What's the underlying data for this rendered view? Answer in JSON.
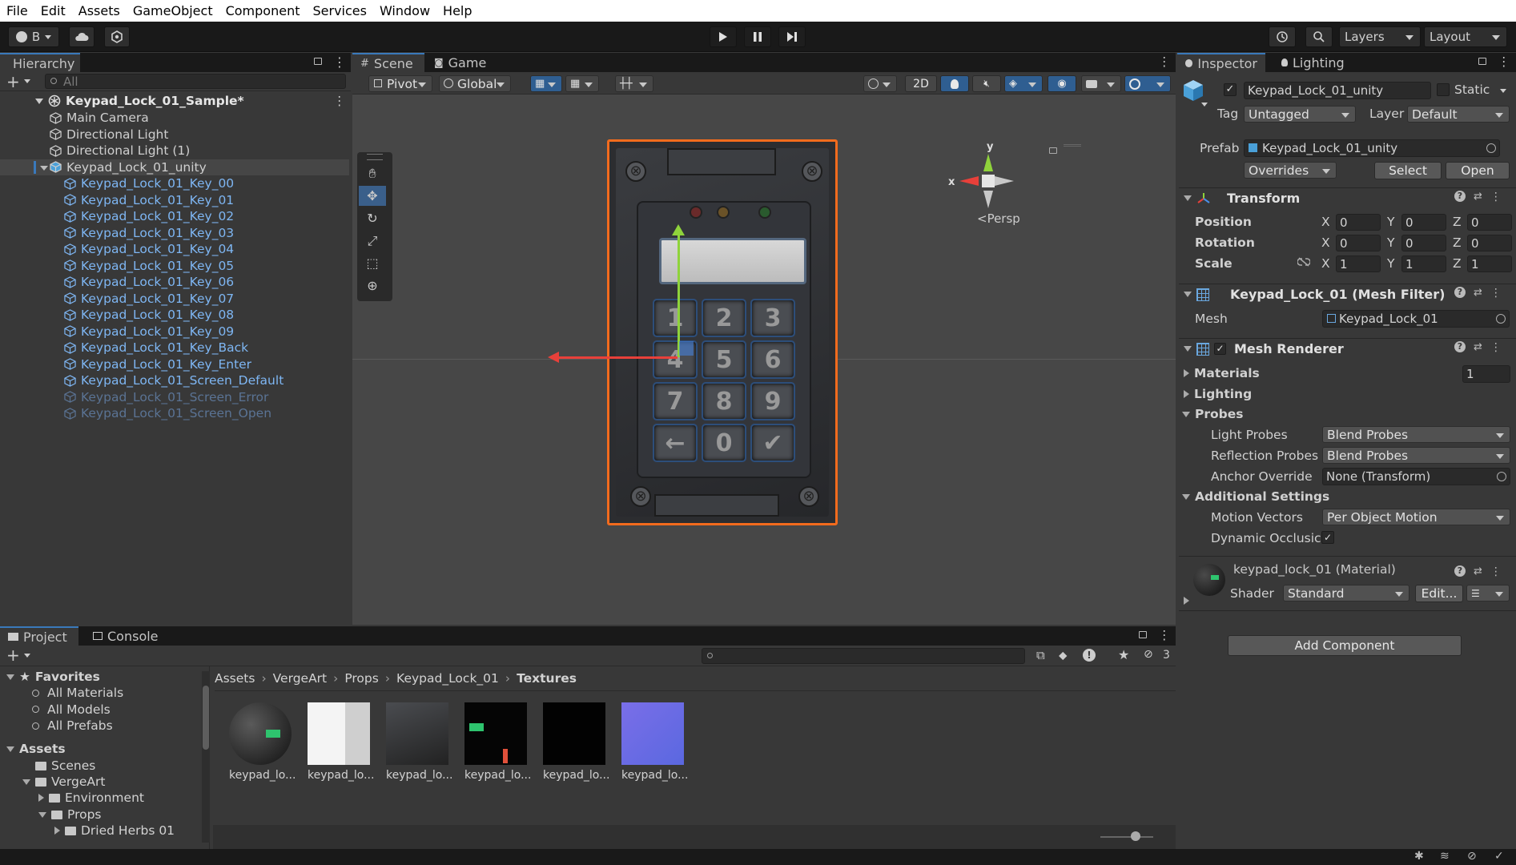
{
  "menu": [
    "File",
    "Edit",
    "Assets",
    "GameObject",
    "Component",
    "Services",
    "Window",
    "Help"
  ],
  "toolbar": {
    "account_label": "B",
    "layers_label": "Layers",
    "layout_label": "Layout"
  },
  "hierarchy": {
    "tab": "Hierarchy",
    "search_placeholder": "All",
    "scene": "Keypad_Lock_01_Sample*",
    "items": [
      {
        "label": "Main Camera",
        "style": "normal",
        "indent": 1
      },
      {
        "label": "Directional Light",
        "style": "normal",
        "indent": 1
      },
      {
        "label": "Directional Light (1)",
        "style": "normal",
        "indent": 1
      },
      {
        "label": "Keypad_Lock_01_unity",
        "style": "normal",
        "indent": 1,
        "selected": true,
        "expanded": true
      },
      {
        "label": "Keypad_Lock_01_Key_00",
        "style": "blue",
        "indent": 2
      },
      {
        "label": "Keypad_Lock_01_Key_01",
        "style": "blue",
        "indent": 2
      },
      {
        "label": "Keypad_Lock_01_Key_02",
        "style": "blue",
        "indent": 2
      },
      {
        "label": "Keypad_Lock_01_Key_03",
        "style": "blue",
        "indent": 2
      },
      {
        "label": "Keypad_Lock_01_Key_04",
        "style": "blue",
        "indent": 2
      },
      {
        "label": "Keypad_Lock_01_Key_05",
        "style": "blue",
        "indent": 2
      },
      {
        "label": "Keypad_Lock_01_Key_06",
        "style": "blue",
        "indent": 2
      },
      {
        "label": "Keypad_Lock_01_Key_07",
        "style": "blue",
        "indent": 2
      },
      {
        "label": "Keypad_Lock_01_Key_08",
        "style": "blue",
        "indent": 2
      },
      {
        "label": "Keypad_Lock_01_Key_09",
        "style": "blue",
        "indent": 2
      },
      {
        "label": "Keypad_Lock_01_Key_Back",
        "style": "blue",
        "indent": 2
      },
      {
        "label": "Keypad_Lock_01_Key_Enter",
        "style": "blue",
        "indent": 2
      },
      {
        "label": "Keypad_Lock_01_Screen_Default",
        "style": "blue",
        "indent": 2
      },
      {
        "label": "Keypad_Lock_01_Screen_Error",
        "style": "dim",
        "indent": 2
      },
      {
        "label": "Keypad_Lock_01_Screen_Open",
        "style": "dim",
        "indent": 2
      }
    ]
  },
  "scene_view": {
    "tabs": [
      "Scene",
      "Game"
    ],
    "pivot": "Pivot",
    "global": "Global",
    "mode_2d": "2D",
    "persp": "<Persp",
    "gizmo_axes": {
      "x": "x",
      "y": "y"
    },
    "keys": [
      "1",
      "2",
      "3",
      "4",
      "5",
      "6",
      "7",
      "8",
      "9",
      "←",
      "0",
      "✔"
    ]
  },
  "inspector": {
    "tabs": [
      "Inspector",
      "Lighting"
    ],
    "object_name": "Keypad_Lock_01_unity",
    "static_label": "Static",
    "tag_label": "Tag",
    "tag_value": "Untagged",
    "layer_label": "Layer",
    "layer_value": "Default",
    "prefab_label": "Prefab",
    "prefab_value": "Keypad_Lock_01_unity",
    "overrides": "Overrides",
    "select": "Select",
    "open": "Open",
    "transform": {
      "title": "Transform",
      "position": {
        "label": "Position",
        "x": "0",
        "y": "0",
        "z": "0"
      },
      "rotation": {
        "label": "Rotation",
        "x": "0",
        "y": "0",
        "z": "0"
      },
      "scale": {
        "label": "Scale",
        "x": "1",
        "y": "1",
        "z": "1"
      },
      "axis_x": "X",
      "axis_y": "Y",
      "axis_z": "Z"
    },
    "mesh_filter": {
      "title": "Keypad_Lock_01 (Mesh Filter)",
      "mesh_label": "Mesh",
      "mesh_value": "Keypad_Lock_01"
    },
    "mesh_renderer": {
      "title": "Mesh Renderer",
      "materials_label": "Materials",
      "materials_count": "1",
      "lighting_label": "Lighting",
      "probes_label": "Probes",
      "light_probes_label": "Light Probes",
      "light_probes_value": "Blend Probes",
      "reflection_probes_label": "Reflection Probes",
      "reflection_probes_value": "Blend Probes",
      "anchor_label": "Anchor Override",
      "anchor_value": "None (Transform)",
      "additional_label": "Additional Settings",
      "motion_vectors_label": "Motion Vectors",
      "motion_vectors_value": "Per Object Motion",
      "dynamic_occlusion_label": "Dynamic Occlusic"
    },
    "material": {
      "title": "keypad_lock_01 (Material)",
      "shader_label": "Shader",
      "shader_value": "Standard",
      "edit": "Edit..."
    },
    "add_component": "Add Component"
  },
  "project": {
    "tabs": [
      "Project",
      "Console"
    ],
    "favorites": {
      "label": "Favorites",
      "items": [
        "All Materials",
        "All Models",
        "All Prefabs"
      ]
    },
    "tree": [
      {
        "label": "Assets",
        "level": 0,
        "bold": true
      },
      {
        "label": "Scenes",
        "level": 1
      },
      {
        "label": "VergeArt",
        "level": 1
      },
      {
        "label": "Environment",
        "level": 2
      },
      {
        "label": "Props",
        "level": 2
      },
      {
        "label": "Dried Herbs 01",
        "level": 3
      }
    ],
    "breadcrumb": [
      "Assets",
      "VergeArt",
      "Props",
      "Keypad_Lock_01",
      "Textures"
    ],
    "hidden_count": "3",
    "thumbnails": [
      "keypad_lo...",
      "keypad_lo...",
      "keypad_lo...",
      "keypad_lo...",
      "keypad_lo...",
      "keypad_lo..."
    ]
  },
  "colors": {
    "accent": "#3a79bb",
    "selection_orange": "#f26b1d",
    "prefab_blue": "#7eb6f3"
  }
}
